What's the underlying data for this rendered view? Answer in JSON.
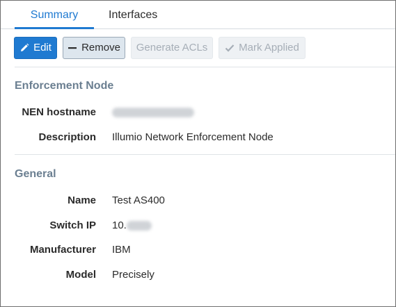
{
  "tabs": [
    {
      "label": "Summary",
      "active": true
    },
    {
      "label": "Interfaces",
      "active": false
    }
  ],
  "toolbar": {
    "edit_label": "Edit",
    "remove_label": "Remove",
    "generate_acls_label": "Generate ACLs",
    "mark_applied_label": "Mark Applied"
  },
  "enforcement_node": {
    "title": "Enforcement Node",
    "hostname_label": "NEN hostname",
    "hostname_value": "",
    "description_label": "Description",
    "description_value": "Illumio Network Enforcement Node"
  },
  "general": {
    "title": "General",
    "name_label": "Name",
    "name_value": "Test AS400",
    "switch_ip_label": "Switch IP",
    "switch_ip_value": "10.",
    "manufacturer_label": "Manufacturer",
    "manufacturer_value": "IBM",
    "model_label": "Model",
    "model_value": "Precisely"
  },
  "colors": {
    "accent": "#1f7ad1",
    "section_title": "#6b7f91",
    "disabled_text": "#a6aeb7"
  },
  "icons": {
    "edit": "pencil-icon",
    "remove": "minus-icon",
    "mark_applied": "checkmark-icon"
  }
}
